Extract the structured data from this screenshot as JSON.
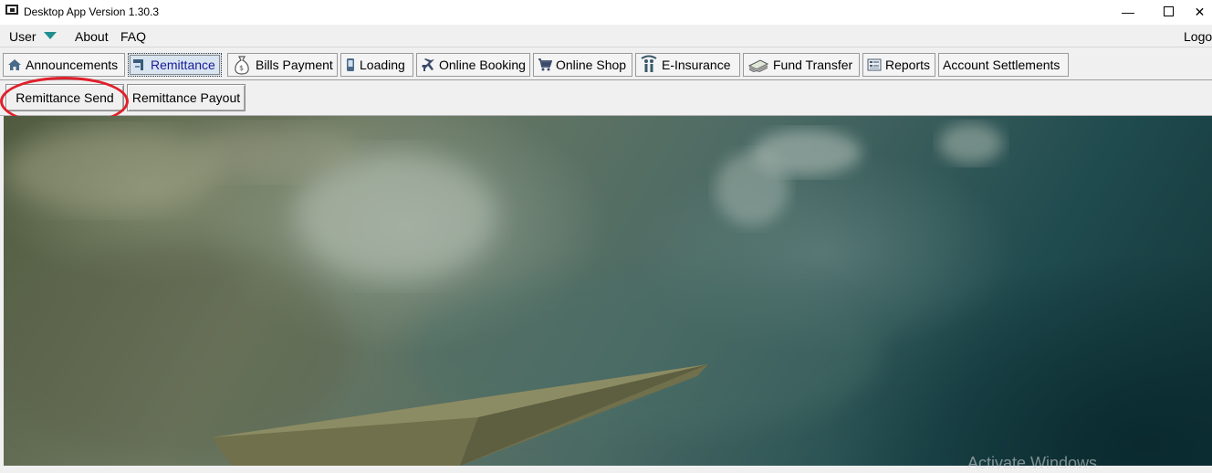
{
  "window": {
    "title": "Desktop App Version 1.30.3",
    "minimize_glyph": "—",
    "close_glyph": "✕"
  },
  "menubar": {
    "user": "User",
    "about": "About",
    "faq": "FAQ",
    "logout_partial": "Logo"
  },
  "tabs": [
    {
      "label": "Announcements",
      "icon": "home-icon"
    },
    {
      "label": "Remittance",
      "icon": "remittance-icon",
      "active": true
    },
    {
      "label": "Bills Payment",
      "icon": "money-bag-icon"
    },
    {
      "label": "Loading",
      "icon": "phone-icon"
    },
    {
      "label": "Online Booking",
      "icon": "airplane-icon"
    },
    {
      "label": "Online Shop",
      "icon": "cart-icon"
    },
    {
      "label": "E-Insurance",
      "icon": "family-icon"
    },
    {
      "label": "Fund Transfer",
      "icon": "cash-stack-icon"
    },
    {
      "label": "Reports",
      "icon": "report-icon"
    },
    {
      "label": "Account Settlements",
      "icon": ""
    }
  ],
  "subtabs": {
    "send": "Remittance Send",
    "payout": "Remittance Payout"
  },
  "annotation_color": "#e0202a",
  "watermark": "Activate Windows"
}
